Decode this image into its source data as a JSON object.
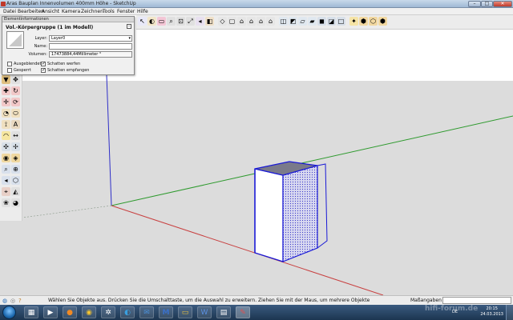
{
  "window": {
    "title": "Aras Bauplan Innenvolumen 400mm Höhe - SketchUp",
    "minimize": "–",
    "maximize": "□",
    "close": "✕"
  },
  "menu": [
    "Datei",
    "Bearbeiten",
    "Ansicht",
    "Kamera",
    "Zeichnen",
    "Tools",
    "Fenster",
    "Hilfe"
  ],
  "top_toolbar_icons": [
    "select-arrow-icon",
    "paint-bucket-icon",
    "eraser-icon",
    "zoom-icon",
    "zoom-window-icon",
    "zoom-extents-icon",
    "previous-view-icon",
    "section-plane-icon",
    "iso-view-icon",
    "top-view-icon",
    "front-view-icon",
    "right-view-icon",
    "back-view-icon",
    "left-view-icon",
    "xray-icon",
    "back-edges-icon",
    "wireframe-icon",
    "hidden-line-icon",
    "shaded-icon",
    "textured-icon",
    "monochrome-icon",
    "components-icon",
    "3d-warehouse-icon",
    "get-models-icon",
    "share-model-icon",
    "layers-icon",
    "outliner-icon"
  ],
  "entity_info": {
    "panel_title": "Elementinformationen",
    "header": "Vol.-Körpergruppe (1 im Modell)",
    "layer_label": "Layer:",
    "layer_value": "Layer0",
    "name_label": "Name:",
    "name_value": "",
    "volume_label": "Volumen:",
    "volume_value": "17473884,44Millimeter ³",
    "hidden_label": "Ausgeblendet",
    "hidden_checked": false,
    "locked_label": "Gesperrt",
    "locked_checked": false,
    "cast_shadows_label": "Schatten werfen",
    "cast_shadows_checked": true,
    "receive_shadows_label": "Schatten empfangen",
    "receive_shadows_checked": true
  },
  "left_toolbar_icons": [
    "orbit-icon",
    "pan-icon",
    "rotate-icon",
    "follow-me-icon",
    "move-icon",
    "offset-icon",
    "tape-measure-icon",
    "text-icon",
    "axes-icon",
    "3d-text-icon",
    "protractor-icon",
    "dimension-icon",
    "position-camera-icon",
    "walk-icon",
    "look-around-icon",
    "section-icon",
    "zoom-icon",
    "zoom-extents-icon",
    "previous-icon",
    "next-icon",
    "add-location-icon",
    "toggle-terrain-icon",
    "footprint-icon",
    "photo-icon"
  ],
  "status": {
    "text": "Wählen Sie Objekte aus. Drücken Sie die Umschalttaste, um die Auswahl zu erweitern. Ziehen Sie mit der Maus, um mehrere Objekte",
    "measurements_label": "Maßangaben",
    "measurements_value": ""
  },
  "taskbar": {
    "apps": [
      "explorer-icon",
      "media-player-icon",
      "firefox-icon",
      "chrome-icon",
      "settings-icon",
      "maxthon-icon",
      "mail-icon",
      "folder-icon",
      "store-icon",
      "word-icon",
      "paint-icon",
      "sketchup-icon"
    ],
    "lang": "DE",
    "time": "20:15",
    "date": "24.03.2013"
  },
  "watermark": "hifi-forum.de",
  "colors": {
    "box_edges": "#1a1ad6",
    "box_face_front": "#ffffff",
    "box_face_side": "#c8c8e8",
    "box_top": "#7a7a8a",
    "axis_red": "#c84040",
    "axis_green": "#2e9a2e",
    "axis_blue": "#2f2fc8",
    "sky": "#ffffff",
    "ground": "#dcdcdc"
  }
}
